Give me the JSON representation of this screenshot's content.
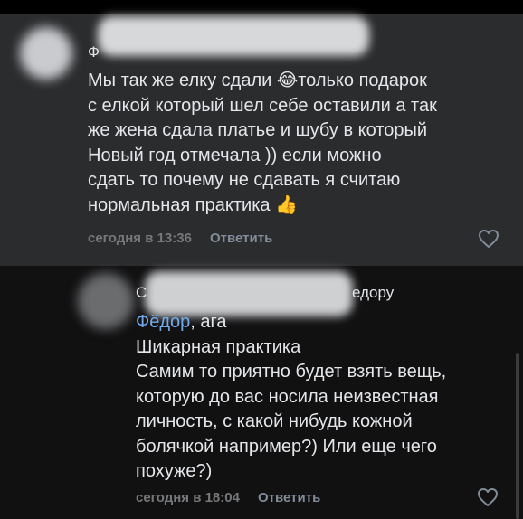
{
  "comments": [
    {
      "author_visible_fragment": "Ф",
      "lines": [
        "Мы так же елку сдали 😂только подарок",
        "с елкой который шел себе оставили а так",
        "же жена сдала платье и шубу в который",
        "Новый год отмечала )) если можно",
        "сдать то почему не сдавать я считаю",
        "нормальная практика 👍"
      ],
      "time": "сегодня в 13:36",
      "reply_label": "Ответить",
      "like_icon": "heart-outline-icon"
    },
    {
      "author_visible_fragment": "С",
      "reply_to_suffix": "едору",
      "reply_to_name": "Фёдор",
      "reply_to_rest": ", ага",
      "lines": [
        "Шикарная практика",
        "Самим то приятно будет взять вещь,",
        "которую до вас носила неизвестная",
        "личность, с какой нибудь кожной",
        "болячкой например?) Или еще чего",
        "похуже?)"
      ],
      "time": "сегодня в 18:04",
      "reply_label": "Ответить",
      "like_icon": "heart-outline-icon"
    }
  ],
  "colors": {
    "comment_bg_highlight": "#2b2c2e",
    "comment_bg": "#111112",
    "link": "#71aaeb",
    "meta": "#76787a"
  }
}
